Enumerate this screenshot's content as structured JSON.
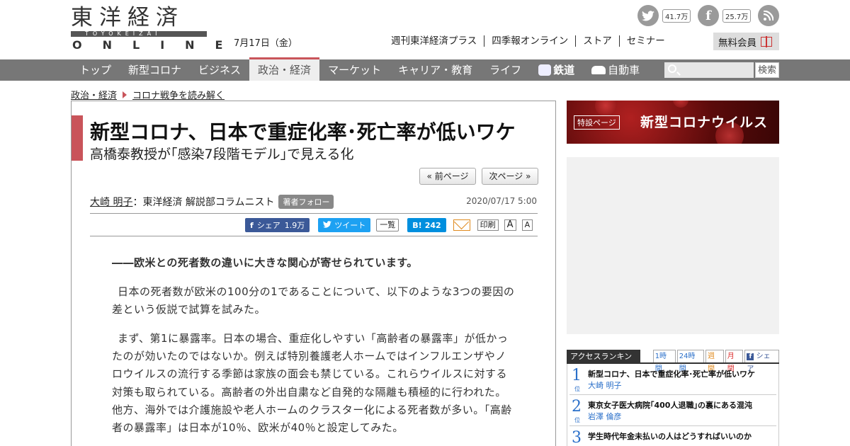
{
  "header": {
    "logo_kanji": "東洋経済",
    "logo_romaji": "TOYOKEIZAI",
    "logo_online": "ONLINE",
    "date": "7月17日（金）",
    "twitter_count": "41.7万",
    "facebook_count": "25.7万",
    "topnav": [
      "週刊東洋経済プラス",
      "四季報オンライン",
      "ストア",
      "セミナー"
    ],
    "member_label": "無料会員"
  },
  "mainnav": {
    "items": [
      "トップ",
      "新型コロナ",
      "ビジネス",
      "政治・経済",
      "マーケット",
      "キャリア・教育",
      "ライフ",
      "鉄道",
      "自動車"
    ],
    "active_index": 3,
    "search_placeholder": "",
    "search_label": "検索"
  },
  "breadcrumb": [
    "政治・経済",
    "コロナ戦争を読み解く"
  ],
  "article": {
    "title": "新型コロナ、日本で重症化率･死亡率が低いワケ",
    "subtitle": "高橋泰教授が｢感染7段階モデル｣で見える化",
    "prev_label": "« 前ページ",
    "next_label": "次ページ »",
    "author": "大崎 明子",
    "author_affiliation": "：東洋経済 解説部コラムニスト",
    "follow_label": "著者フォロー",
    "published": "2020/07/17 5:00",
    "share": {
      "fb_label": "シェア",
      "fb_count": "1.9万",
      "tw_label": "ツイート",
      "list_label": "一覧",
      "hatena_label": "B!",
      "hatena_count": "242",
      "print_label": "印刷",
      "font_large": "A",
      "font_small": "A"
    },
    "lead": "――欧米との死者数の違いに大きな関心が寄せられています。",
    "paragraph1": "日本の死者数が欧米の100分の1であることについて、以下のような3つの要因の差という仮説で試算を試みた。",
    "paragraph2": "まず、第1に暴露率。日本の場合、重症化しやすい「高齢者の暴露率」が低かったのが効いたのではないか。例えば特別養護老人ホームではインフルエンザやノロウイルスの流行する季節は家族の面会も禁じている。これらウイルスに対する対策も取られている。高齢者の外出自粛など自発的な隔離も積極的に行われた。他方、海外では介護施設や老人ホームのクラスター化による死者数が多い。「高齢者の暴露率」は日本が10％、欧米が40％と設定してみた。"
  },
  "sidebar": {
    "banner_tag": "特設ページ",
    "banner_title": "新型コロナウイルス",
    "ranking_title": "アクセスランキング",
    "ranking_tabs": [
      "1時間",
      "24時間",
      "週間",
      "月間",
      "シェア"
    ],
    "ranking": [
      {
        "rank": "1",
        "suffix": "位",
        "title": "新型コロナ、日本で重症化率･死亡率が低いワケ",
        "author": "大崎 明子"
      },
      {
        "rank": "2",
        "suffix": "位",
        "title": "東京女子医大病院｢400人退職｣の裏にある混沌",
        "author": "岩澤 倫彦"
      },
      {
        "rank": "3",
        "suffix": "位",
        "title": "学生時代年金未払いの人はどうすればいいのか",
        "author": ""
      }
    ]
  },
  "colors": {
    "accent": "#c9545a",
    "nav_bg": "#777777",
    "facebook": "#3b5998",
    "twitter": "#1da1f2",
    "hatena": "#008fde",
    "rank_blue": "#2a6fc9"
  }
}
